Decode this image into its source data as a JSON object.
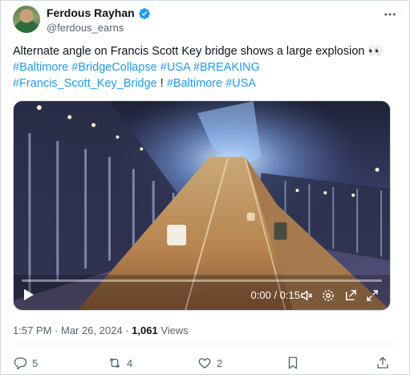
{
  "author": {
    "name": "Ferdous Rayhan",
    "handle": "@ferdous_earns",
    "verified": true
  },
  "tweet": {
    "text_main": "Alternate angle on Francis Scott Key bridge shows a large explosion 👀",
    "line2_tags": [
      "#Baltimore",
      "#BridgeCollapse",
      "#USA",
      "#BREAKING"
    ],
    "line3_tag1": "#Francis_Scott_Key_Bridge",
    "line3_sep": " ! ",
    "line3_tags": [
      "#Baltimore",
      "#USA"
    ]
  },
  "video": {
    "time_display": "0:00 / 0:15",
    "progress_fraction": 0.0,
    "controls": [
      "play-icon",
      "volume-icon",
      "settings-icon",
      "pop-out-icon",
      "fullscreen-icon"
    ]
  },
  "meta": {
    "time": "1:57 PM",
    "sep": " · ",
    "date": "Mar 26, 2024",
    "views_count": "1,061",
    "views_label": " Views"
  },
  "actions": {
    "reply_count": "5",
    "retweet_count": "4",
    "like_count": "2"
  },
  "colors": {
    "link": "#1d9bf0",
    "secondary_text": "#536471",
    "verified": "#1d9bf0"
  }
}
